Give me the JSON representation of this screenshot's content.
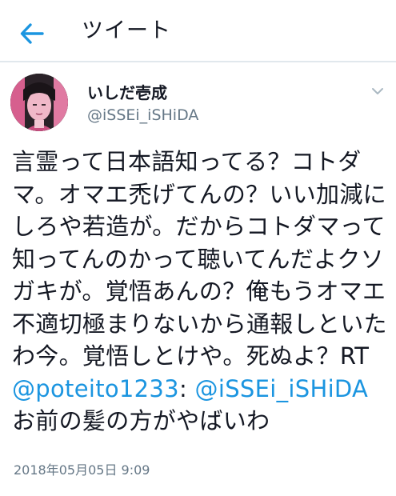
{
  "header": {
    "title": "ツイート"
  },
  "tweet": {
    "display_name": "いしだ壱成",
    "handle": "@iSSEi_iSHiDA",
    "text_part1": "言霊って日本語知ってる？コトダマ。オマエ禿げてんの？いい加減にしろや若造が。だからコトダマって知ってんのかって聴いてんだよクソガキが。覚悟あんの？俺もうオマエ不適切極まりないから通報しといたわ今。覚悟しとけや。死ぬよ？RT ",
    "mention1": "@poteito1233",
    "colon": ":",
    "mention2": "@iSSEi_iSHiDA",
    "text_part2": " お前の髪の方がやばいわ",
    "timestamp": "2018年05月05日 9:09"
  },
  "colors": {
    "accent": "#1b95e0",
    "secondary_text": "#657786",
    "primary_text": "#141823",
    "avatar_bg": "#e86a9a"
  },
  "icons": {
    "back": "back-arrow-icon",
    "caret": "chevron-down-icon"
  }
}
